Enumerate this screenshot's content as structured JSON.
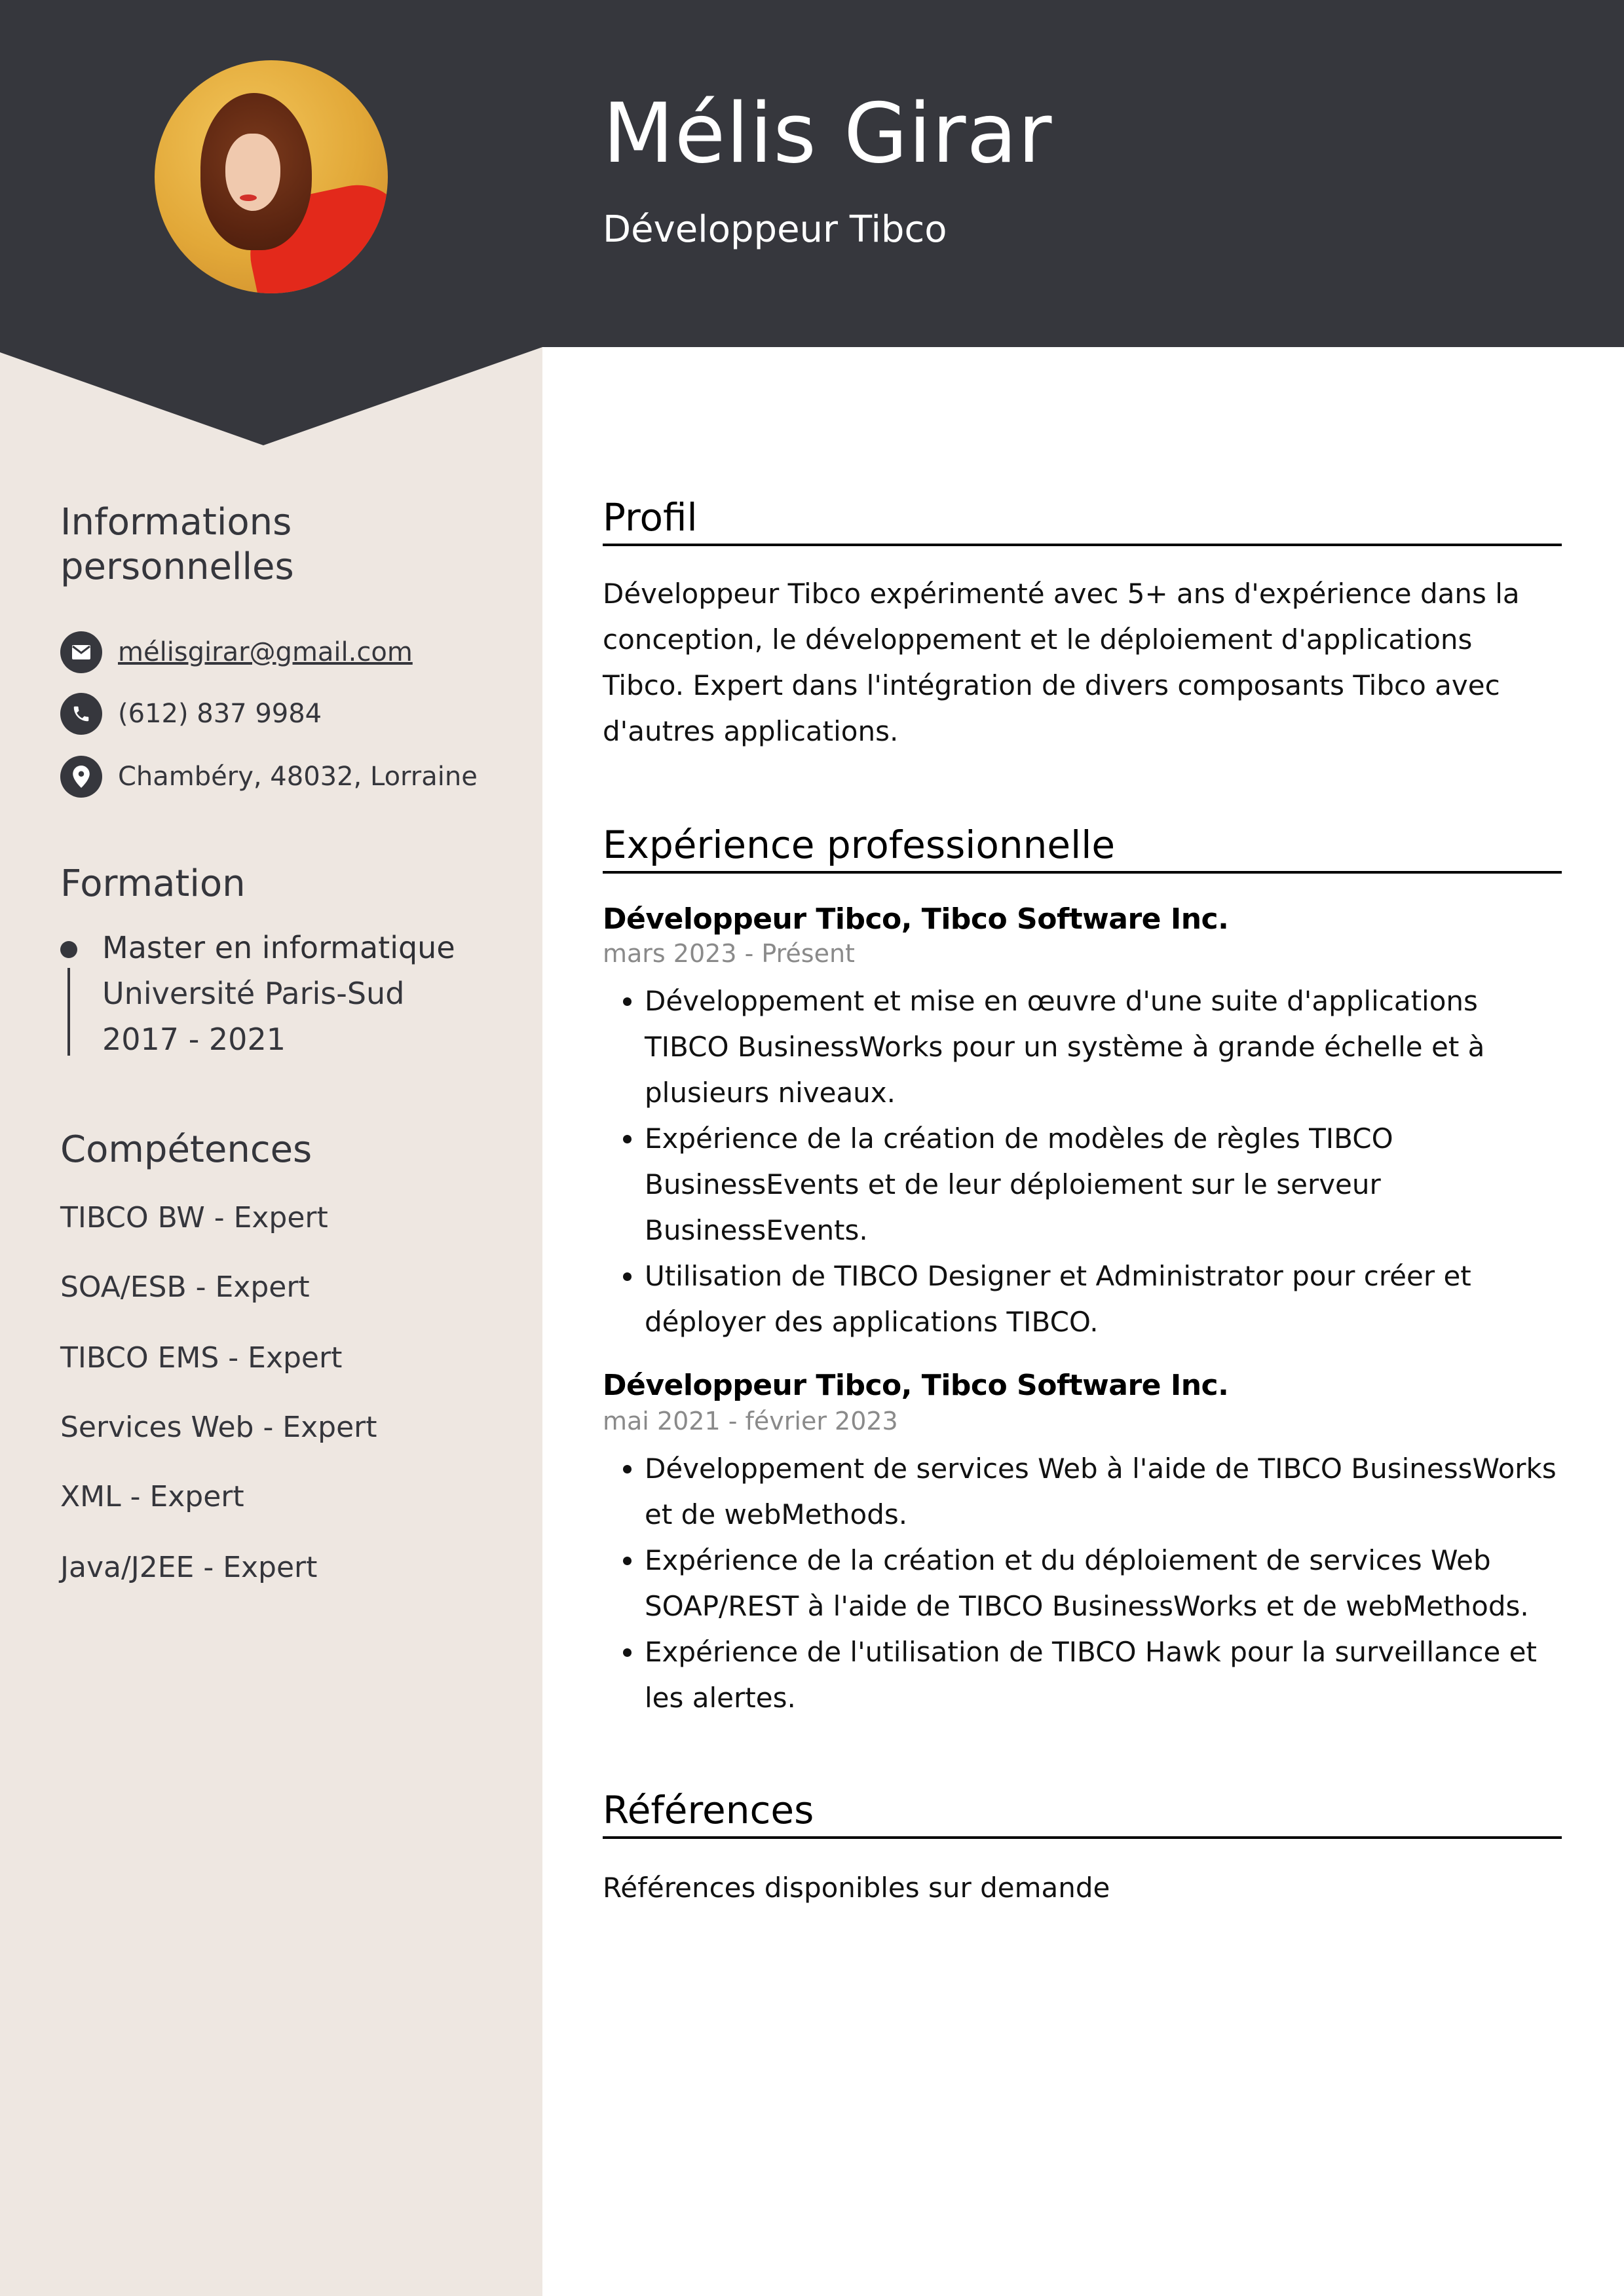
{
  "colors": {
    "header_bg": "#36373d",
    "sidebar_bg": "#eee7e1",
    "text_dark": "#35363c",
    "date_gray": "#8a8a8a"
  },
  "header": {
    "name": "Mélis Girar",
    "title": "Développeur Tibco",
    "photo_alt": "profile-photo"
  },
  "sidebar": {
    "personal": {
      "heading_line1": "Informations",
      "heading_line2": "personnelles",
      "email": "mélisgirar@gmail.com",
      "phone": "(612) 837 9984",
      "address": "Chambéry, 48032, Lorraine",
      "icons": [
        "envelope-icon",
        "phone-icon",
        "location-pin-icon"
      ]
    },
    "education": {
      "heading": "Formation",
      "degree": "Master en informatique",
      "school": "Université Paris-Sud",
      "years": "2017 - 2021"
    },
    "skills": {
      "heading": "Compétences",
      "items": [
        "TIBCO BW - Expert",
        "SOA/ESB - Expert",
        "TIBCO EMS - Expert",
        "Services Web - Expert",
        "XML - Expert",
        "Java/J2EE - Expert"
      ]
    }
  },
  "main": {
    "profile": {
      "heading": "Profil",
      "text": "Développeur Tibco expérimenté avec 5+ ans d'expérience dans la conception, le développement et le déploiement d'applications Tibco. Expert dans l'intégration de divers composants Tibco avec d'autres applications."
    },
    "experience": {
      "heading": "Expérience professionnelle",
      "jobs": [
        {
          "title": "Développeur Tibco, Tibco Software Inc.",
          "dates": "mars 2023 - Présent",
          "bullets": [
            "Développement et mise en œuvre d'une suite d'applications TIBCO BusinessWorks pour un système à grande échelle et à plusieurs niveaux.",
            "Expérience de la création de modèles de règles TIBCO BusinessEvents et de leur déploiement sur le serveur BusinessEvents.",
            "Utilisation de TIBCO Designer et Administrator pour créer et déployer des applications TIBCO."
          ]
        },
        {
          "title": "Développeur Tibco, Tibco Software Inc.",
          "dates": "mai 2021 - février 2023",
          "bullets": [
            "Développement de services Web à l'aide de TIBCO BusinessWorks et de webMethods.",
            "Expérience de la création et du déploiement de services Web SOAP/REST à l'aide de TIBCO BusinessWorks et de webMethods.",
            "Expérience de l'utilisation de TIBCO Hawk pour la surveillance et les alertes."
          ]
        }
      ]
    },
    "references": {
      "heading": "Références",
      "text": "Références disponibles sur demande"
    }
  }
}
